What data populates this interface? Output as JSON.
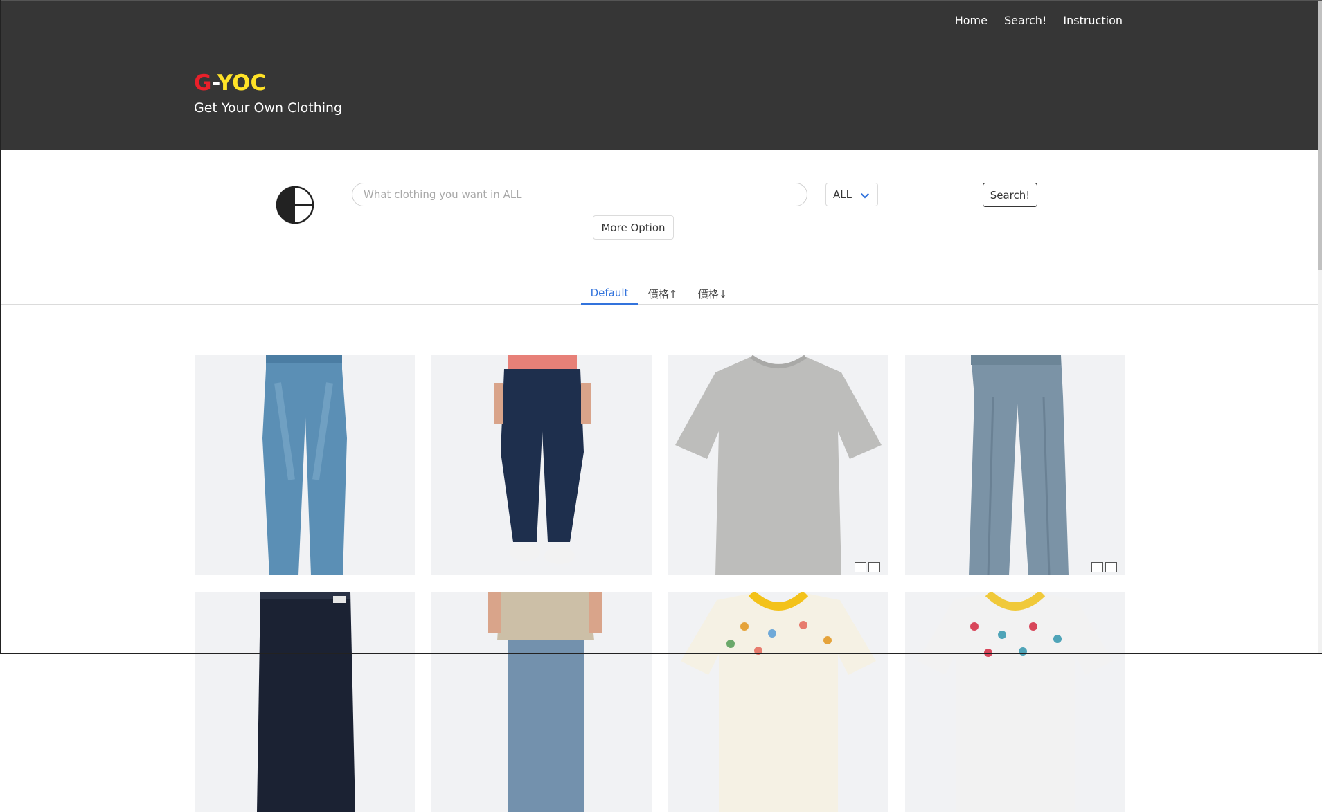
{
  "nav": {
    "items": [
      {
        "label": "Home"
      },
      {
        "label": "Search!"
      },
      {
        "label": "Instruction"
      }
    ]
  },
  "brand": {
    "g": "G",
    "dash": "-",
    "yoc": "YOC",
    "tagline": "Get Your Own Clothing",
    "colors": {
      "g": "#e8202a",
      "yoc": "#ffe227",
      "hero_bg": "#363636"
    }
  },
  "search": {
    "placeholder": "What clothing you want in ALL",
    "value": "",
    "category_selected": "ALL",
    "search_button": "Search!",
    "more_option_button": "More Option"
  },
  "sort_tabs": [
    {
      "label": "Default",
      "active": true
    },
    {
      "label": "價格↑",
      "active": false
    },
    {
      "label": "價格↓",
      "active": false
    }
  ],
  "products": [
    {
      "kind": "light-wash jeans",
      "icon": "jeans-image"
    },
    {
      "kind": "dark denim jogger pants",
      "icon": "jogger-pants-image"
    },
    {
      "kind": "gray t-shirt",
      "icon": "tshirt-image"
    },
    {
      "kind": "blue-gray trousers",
      "icon": "trousers-image"
    },
    {
      "kind": "navy pants",
      "icon": "pants-image"
    },
    {
      "kind": "beige shirt with jeans",
      "icon": "model-image"
    },
    {
      "kind": "kids printed t-shirt animals",
      "icon": "kids-tshirt-image"
    },
    {
      "kind": "kids printed t-shirt characters",
      "icon": "kids-tshirt-image"
    }
  ],
  "accent_color": "#3273dc"
}
